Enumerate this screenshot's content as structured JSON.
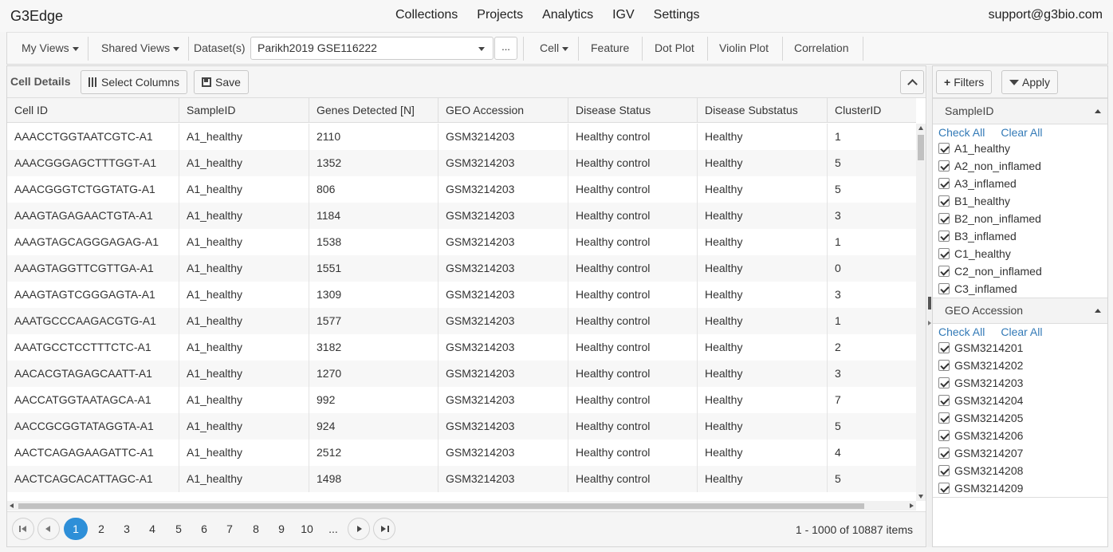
{
  "app": {
    "brand": "G3Edge",
    "nav": [
      "Collections",
      "Projects",
      "Analytics",
      "IGV",
      "Settings"
    ],
    "support": "support@g3bio.com"
  },
  "toolbar": {
    "my_views": "My Views",
    "shared_views": "Shared Views",
    "datasets_label": "Dataset(s)",
    "dataset_value": "Parikh2019 GSE116222",
    "more_label": "...",
    "cell": "Cell",
    "feature": "Feature",
    "dot_plot": "Dot Plot",
    "violin_plot": "Violin Plot",
    "correlation": "Correlation"
  },
  "grid": {
    "title": "Cell Details",
    "select_columns": "Select Columns",
    "save": "Save",
    "columns": [
      "Cell ID",
      "SampleID",
      "Genes Detected [N]",
      "GEO Accession",
      "Disease Status",
      "Disease Substatus",
      "ClusterID"
    ],
    "rows": [
      [
        "AAACCTGGTAATCGTC-A1",
        "A1_healthy",
        "2110",
        "GSM3214203",
        "Healthy control",
        "Healthy",
        "1"
      ],
      [
        "AAACGGGAGCTTTGGT-A1",
        "A1_healthy",
        "1352",
        "GSM3214203",
        "Healthy control",
        "Healthy",
        "5"
      ],
      [
        "AAACGGGTCTGGTATG-A1",
        "A1_healthy",
        "806",
        "GSM3214203",
        "Healthy control",
        "Healthy",
        "5"
      ],
      [
        "AAAGTAGAGAACTGTA-A1",
        "A1_healthy",
        "1184",
        "GSM3214203",
        "Healthy control",
        "Healthy",
        "3"
      ],
      [
        "AAAGTAGCAGGGAGAG-A1",
        "A1_healthy",
        "1538",
        "GSM3214203",
        "Healthy control",
        "Healthy",
        "1"
      ],
      [
        "AAAGTAGGTTCGTTGA-A1",
        "A1_healthy",
        "1551",
        "GSM3214203",
        "Healthy control",
        "Healthy",
        "0"
      ],
      [
        "AAAGTAGTCGGGAGTA-A1",
        "A1_healthy",
        "1309",
        "GSM3214203",
        "Healthy control",
        "Healthy",
        "3"
      ],
      [
        "AAATGCCCAAGACGTG-A1",
        "A1_healthy",
        "1577",
        "GSM3214203",
        "Healthy control",
        "Healthy",
        "1"
      ],
      [
        "AAATGCCTCCTTTCTC-A1",
        "A1_healthy",
        "3182",
        "GSM3214203",
        "Healthy control",
        "Healthy",
        "2"
      ],
      [
        "AACACGTAGAGCAATT-A1",
        "A1_healthy",
        "1270",
        "GSM3214203",
        "Healthy control",
        "Healthy",
        "3"
      ],
      [
        "AACCATGGTAATAGCA-A1",
        "A1_healthy",
        "992",
        "GSM3214203",
        "Healthy control",
        "Healthy",
        "7"
      ],
      [
        "AACCGCGGTATAGGTA-A1",
        "A1_healthy",
        "924",
        "GSM3214203",
        "Healthy control",
        "Healthy",
        "5"
      ],
      [
        "AACTCAGAGAAGATTC-A1",
        "A1_healthy",
        "2512",
        "GSM3214203",
        "Healthy control",
        "Healthy",
        "4"
      ],
      [
        "AACTCAGCACATTAGC-A1",
        "A1_healthy",
        "1498",
        "GSM3214203",
        "Healthy control",
        "Healthy",
        "5"
      ]
    ]
  },
  "pager": {
    "pages": [
      "1",
      "2",
      "3",
      "4",
      "5",
      "6",
      "7",
      "8",
      "9",
      "10",
      "..."
    ],
    "active_page": "1",
    "info": "1 - 1000 of 10887 items"
  },
  "filters": {
    "filters_btn": "Filters",
    "apply_btn": "Apply",
    "check_all": "Check All",
    "clear_all": "Clear All",
    "sections": [
      {
        "title": "SampleID",
        "items": [
          "A1_healthy",
          "A2_non_inflamed",
          "A3_inflamed",
          "B1_healthy",
          "B2_non_inflamed",
          "B3_inflamed",
          "C1_healthy",
          "C2_non_inflamed",
          "C3_inflamed"
        ]
      },
      {
        "title": "GEO Accession",
        "items": [
          "GSM3214201",
          "GSM3214202",
          "GSM3214203",
          "GSM3214204",
          "GSM3214205",
          "GSM3214206",
          "GSM3214207",
          "GSM3214208",
          "GSM3214209"
        ]
      }
    ]
  },
  "colors": {
    "accent": "#2e8fd8",
    "link": "#337ab7"
  }
}
